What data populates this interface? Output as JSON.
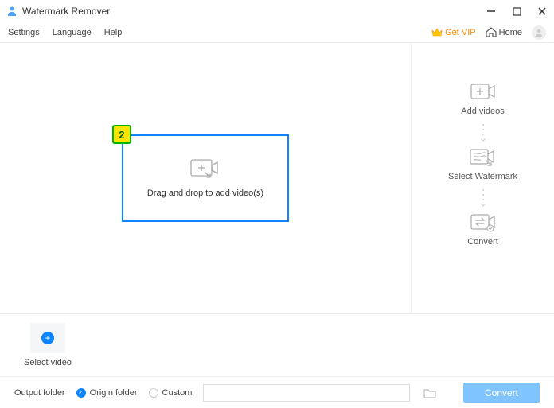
{
  "titlebar": {
    "app_name": "Watermark Remover"
  },
  "menu": {
    "settings": "Settings",
    "language": "Language",
    "help": "Help",
    "get_vip": "Get VIP",
    "home": "Home"
  },
  "dropzone": {
    "badge": "2",
    "text": "Drag and drop to add video(s)"
  },
  "steps": {
    "add": "Add videos",
    "select": "Select Watermark",
    "convert": "Convert"
  },
  "thumb": {
    "label": "Select video"
  },
  "output": {
    "label": "Output folder",
    "origin": "Origin folder",
    "custom": "Custom",
    "path": ""
  },
  "convert_button": "Convert"
}
